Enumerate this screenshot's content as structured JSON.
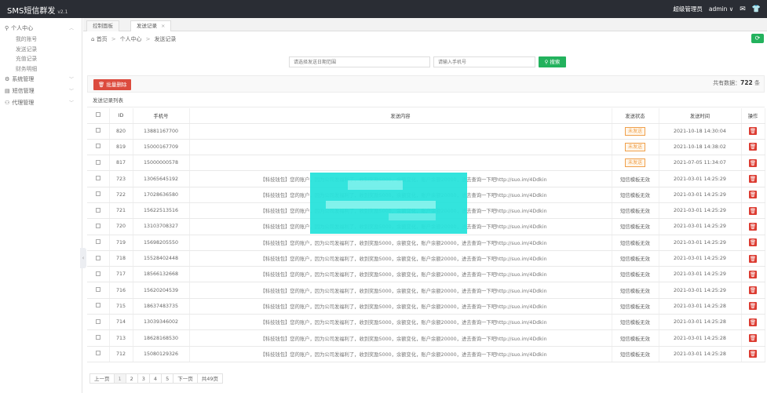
{
  "header": {
    "brand": "SMS短信群发",
    "version": "v2.1",
    "role_label": "超级管理员",
    "user": "admin",
    "user_caret": "∨",
    "mail_icon": "mail-icon",
    "shirt_icon": "shirt-icon"
  },
  "sidebar": {
    "groups": [
      {
        "label": "个人中心",
        "icon": "person-icon",
        "expanded": true,
        "items": [
          "我的账号",
          "发送记录",
          "充值记录",
          "财务明细"
        ]
      },
      {
        "label": "系统管理",
        "icon": "gear-icon"
      },
      {
        "label": "短信管理",
        "icon": "message-icon"
      },
      {
        "label": "代理管理",
        "icon": "users-icon"
      }
    ]
  },
  "tabs": [
    {
      "label": "控制面板"
    },
    {
      "label": "发送记录",
      "close": "×"
    }
  ],
  "breadcrumb": {
    "home": "首页",
    "items": [
      "个人中心",
      "发送记录"
    ],
    "sep": ">"
  },
  "search": {
    "date_placeholder": "请选择发送日期范围",
    "phone_placeholder": "请输入手机号",
    "button": "搜索"
  },
  "toolbar": {
    "batch_delete": "批量删除",
    "total_label": "共有数据：",
    "total_value": "722",
    "total_unit": "条"
  },
  "list_title": "发送记录列表",
  "table": {
    "headers": [
      "ID",
      "手机号",
      "发送内容",
      "发送状态",
      "发送时间",
      "操作"
    ],
    "rows": [
      {
        "id": "820",
        "phone": "13881167700",
        "content": "",
        "status": "未发送",
        "time": "2021-10-18 14:30:04"
      },
      {
        "id": "819",
        "phone": "15000167709",
        "content": "",
        "status": "未发送",
        "time": "2021-10-18 14:38:02"
      },
      {
        "id": "817",
        "phone": "15000000578",
        "content": "",
        "status": "未发送",
        "time": "2021-07-05 11:34:07"
      },
      {
        "id": "723",
        "phone": "13065645192",
        "content": "【科技钱包】您的账户，因为公司发福利了，收到奖励5000，余额变化，账户余额20000，进去查询一下吧http://suo.im/4Ddkin",
        "status": "短信模板无效",
        "time": "2021-03-01 14:25:29"
      },
      {
        "id": "722",
        "phone": "17028636580",
        "content": "【科技钱包】您的账户，因为公司发福利了，收到奖励5000，余额变化，账户余额20000，进去查询一下吧http://suo.im/4Ddkin",
        "status": "短信模板无效",
        "time": "2021-03-01 14:25:29"
      },
      {
        "id": "721",
        "phone": "15622513516",
        "content": "【科技钱包】您的账户，因为公司发福利了，收到奖励5000，余额变化，账户余额20000，进去查询一下吧http://suo.im/4Ddkin",
        "status": "短信模板无效",
        "time": "2021-03-01 14:25:29"
      },
      {
        "id": "720",
        "phone": "13103708327",
        "content": "【科技钱包】您的账户，因为公司发福利了，收到奖励5000，余额变化，账户余额20000，进去查询一下吧http://suo.im/4Ddkin",
        "status": "短信模板无效",
        "time": "2021-03-01 14:25:29"
      },
      {
        "id": "719",
        "phone": "15698205550",
        "content": "【科技钱包】您的账户，因为公司发福利了，收到奖励5000，余额变化，账户余额20000，进去查询一下吧http://suo.im/4Ddkin",
        "status": "短信模板无效",
        "time": "2021-03-01 14:25:29"
      },
      {
        "id": "718",
        "phone": "15528402448",
        "content": "【科技钱包】您的账户，因为公司发福利了，收到奖励5000，余额变化，账户余额20000，进去查询一下吧http://suo.im/4Ddkin",
        "status": "短信模板无效",
        "time": "2021-03-01 14:25:29"
      },
      {
        "id": "717",
        "phone": "18566132668",
        "content": "【科技钱包】您的账户，因为公司发福利了，收到奖励5000，余额变化，账户余额20000，进去查询一下吧http://suo.im/4Ddkin",
        "status": "短信模板无效",
        "time": "2021-03-01 14:25:29"
      },
      {
        "id": "716",
        "phone": "15620204539",
        "content": "【科技钱包】您的账户，因为公司发福利了，收到奖励5000，余额变化，账户余额20000，进去查询一下吧http://suo.im/4Ddkin",
        "status": "短信模板无效",
        "time": "2021-03-01 14:25:29"
      },
      {
        "id": "715",
        "phone": "18637483735",
        "content": "【科技钱包】您的账户，因为公司发福利了，收到奖励5000，余额变化，账户余额20000，进去查询一下吧http://suo.im/4Ddkin",
        "status": "短信模板无效",
        "time": "2021-03-01 14:25:28"
      },
      {
        "id": "714",
        "phone": "13039346002",
        "content": "【科技钱包】您的账户，因为公司发福利了，收到奖励5000，余额变化，账户余额20000，进去查询一下吧http://suo.im/4Ddkin",
        "status": "短信模板无效",
        "time": "2021-03-01 14:25:28"
      },
      {
        "id": "713",
        "phone": "18628168530",
        "content": "【科技钱包】您的账户，因为公司发福利了，收到奖励5000，余额变化，账户余额20000，进去查询一下吧http://suo.im/4Ddkin",
        "status": "短信模板无效",
        "time": "2021-03-01 14:25:28"
      },
      {
        "id": "712",
        "phone": "15080129326",
        "content": "【科技钱包】您的账户，因为公司发福利了，收到奖励5000，余额变化，账户余额20000，进去查询一下吧http://suo.im/4Ddkin",
        "status": "短信模板无效",
        "time": "2021-03-01 14:25:28"
      }
    ]
  },
  "pagination": {
    "prev": "上一页",
    "pages": [
      "1",
      "2",
      "3",
      "4",
      "5"
    ],
    "next": "下一页",
    "total_pages": "共49页"
  },
  "colors": {
    "green": "#23b25d",
    "red": "#dc4b3e",
    "topbar": "#2a2d34",
    "pending": "#f0a04b"
  }
}
